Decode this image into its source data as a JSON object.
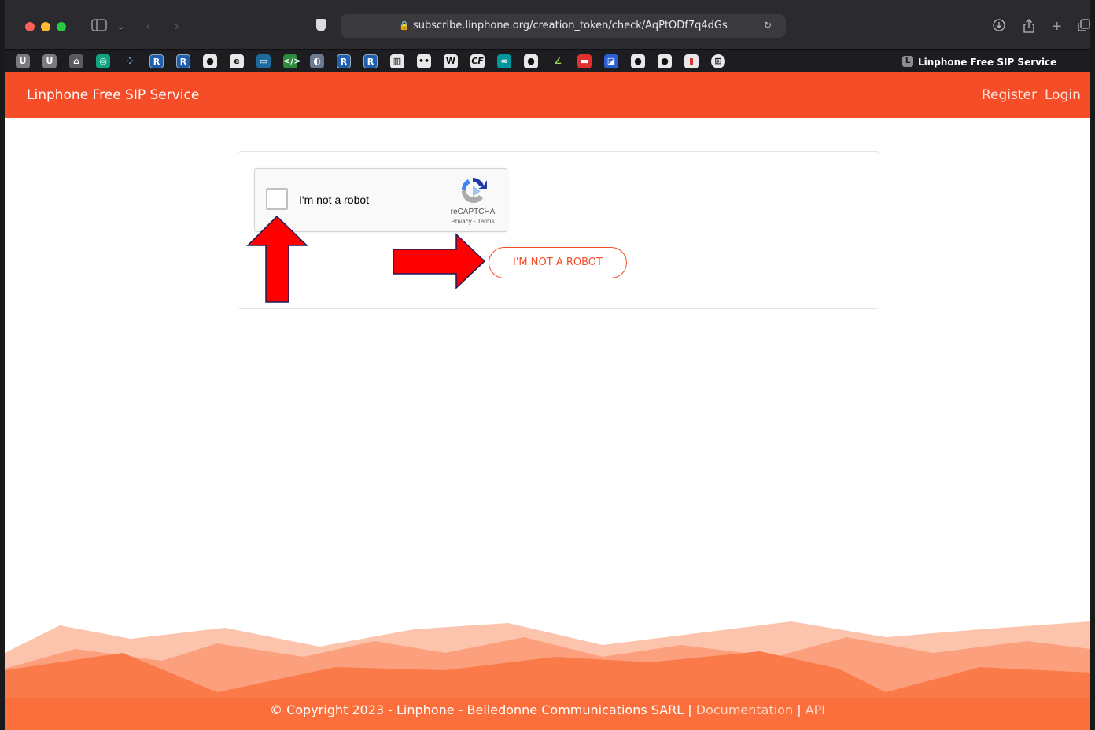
{
  "browser": {
    "url": "subscribe.linphone.org/creation_token/check/AqPtODf7q4dGs",
    "tab_title": "Linphone Free SIP Service",
    "tab_favicon_letter": "L",
    "favorites": [
      "U",
      "U",
      "",
      "",
      "",
      "R",
      "R",
      "",
      "",
      "",
      "",
      "",
      "R",
      "R",
      "",
      "",
      "",
      "CF",
      "",
      "",
      "",
      "",
      "",
      "",
      "",
      "",
      ""
    ]
  },
  "site": {
    "brand": "Linphone Free SIP Service",
    "nav": {
      "register": "Register",
      "login": "Login"
    },
    "accent": "#f44d28"
  },
  "captcha": {
    "label": "I'm not a robot",
    "brand": "reCAPTCHA",
    "privacy": "Privacy",
    "separator": " - ",
    "terms": "Terms"
  },
  "form": {
    "submit_label": "I'M NOT A ROBOT"
  },
  "footer": {
    "copyright": "© Copyright 2023 - Linphone - Belledonne Communications SARL",
    "sep1": " | ",
    "documentation": "Documentation",
    "sep2": " | ",
    "api": "API"
  }
}
